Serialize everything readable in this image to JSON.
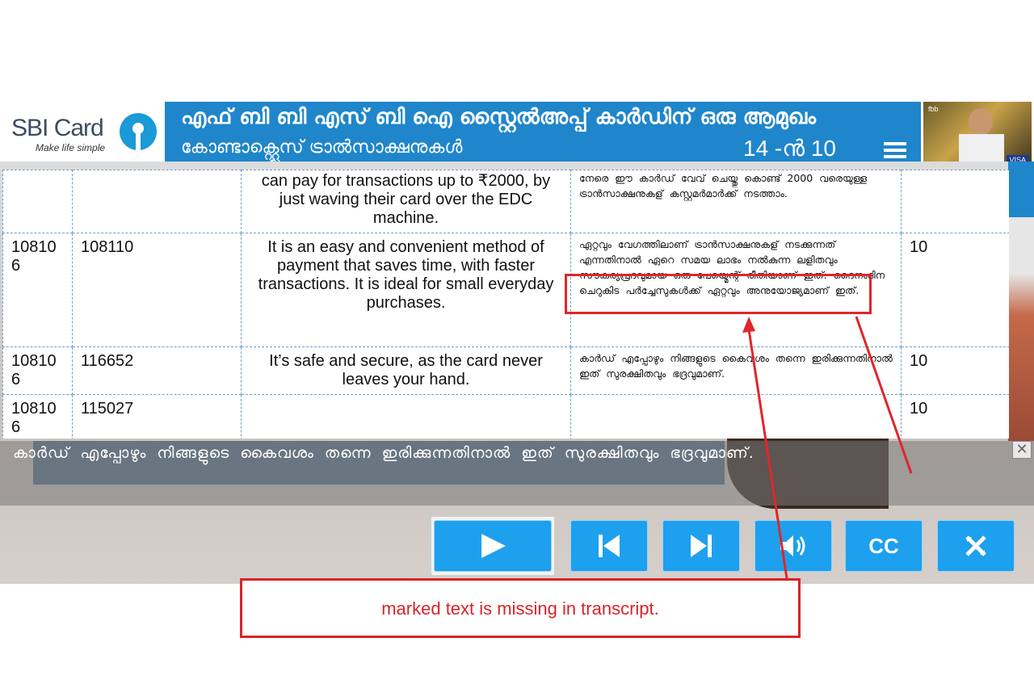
{
  "header": {
    "logo_text": "SBI Card",
    "logo_tagline": "Make life simple",
    "title": "എഫ് ബി ബി എസ് ബി ഐ സ്റ്റൈൽഅപ്പ് കാർഡിന് ഒരു ആമുഖം",
    "subtitle": "കോണ്ടാക്റ്റ്ലെസ് ട്രാൽസാക്ഷനുകൾ",
    "page": "14 -ൻ 10",
    "thumb_brand": "fbb",
    "thumb_badge": "VISA"
  },
  "transcript": {
    "rows": [
      {
        "col1": "",
        "col2": "",
        "english": "can pay for transactions up to ₹2000, by just waving their card over the EDC machine.",
        "malayalam": "നേരെ ഈ കാർഡ് വേവ് ചെയ്തു കൊണ്ട് 2000 വരെയുള്ള ട്രാൻസാക്ഷനുകള് കസ്റ്റമർമാർക്ക് നടത്താം.",
        "col5": ""
      },
      {
        "col1": "108106",
        "col2": "108110",
        "english": "It is an easy and convenient method of payment that saves time, with faster transactions. It is ideal for small everyday purchases.",
        "malayalam": "ഏറ്റവും വേഗത്തിലാണ് ട്രാൻസാക്ഷനുകള് നടക്കുന്നത് എന്നതിനാൽ ഏറെ സമയ ലാഭം നൽകുന്ന ലളിതവും സൗകര്യപ്രദവുമായ ഒരു പേയ്മെന്റ് രീതിയാണ് ഇത്. ദൈനംദിന ചെറുകിട പർച്ചേസുകൾക്ക് ഏറ്റവും അനുയോജ്യമാണ് ഇത്.",
        "col5": "10"
      },
      {
        "col1": "108106",
        "col2": "116652",
        "english": "It’s safe and secure, as the card never leaves your hand.",
        "malayalam": "കാർഡ് എപ്പോഴും നിങ്ങളുടെ കൈവശം തന്നെ ഇരിക്കുന്നതിനാൽ ഇത് സുരക്ഷിതവും ഭദ്രവുമാണ്.",
        "col5": "10"
      },
      {
        "col1": "108106",
        "col2": "115027",
        "english": "",
        "malayalam": "",
        "col5": "10"
      }
    ]
  },
  "subtitle_bar": {
    "text": "കാർഡ് എപ്പോഴും നിങ്ങളുടെ കൈവശം തന്നെ ഇരിക്കുന്നതിനാൽ ഇത് സുരക്ഷിതവും ഭദ്രവുമാണ്.",
    "close": "✕"
  },
  "controls": {
    "cc_label": "CC"
  },
  "annotation": {
    "note": "marked text is missing in transcript."
  }
}
